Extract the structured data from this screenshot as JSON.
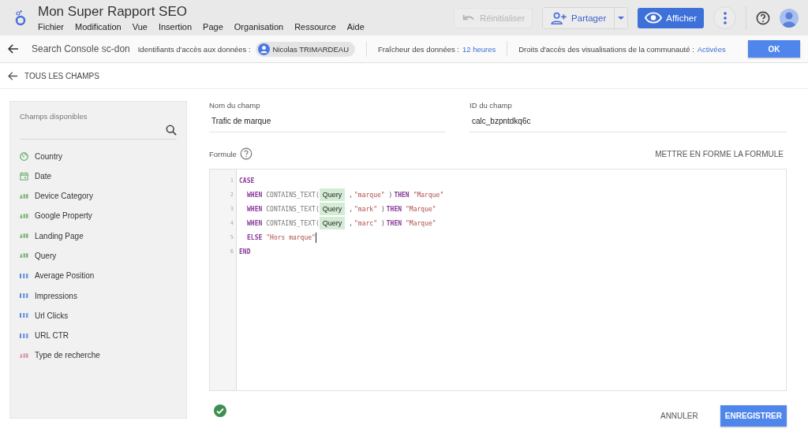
{
  "report": {
    "title": "Mon Super Rapport SEO",
    "menu": [
      "Fichier",
      "Modification",
      "Vue",
      "Insertion",
      "Page",
      "Organisation",
      "Ressource",
      "Aide"
    ]
  },
  "toolbar": {
    "reset": {
      "label": "Réinitialiser",
      "disabled": true
    },
    "share": "Partager",
    "view": "Afficher"
  },
  "source_bar": {
    "source": "Search Console sc-don",
    "credentials_label": "Identifiants d'accès aux données :",
    "owner": "Nicolas TRIMARDEAU",
    "freshness_label": "Fraîcheur des données :",
    "freshness": "12 heures",
    "rights_label": "Droits d'accès des visualisations de la communauté :",
    "rights": "Activées",
    "ok": "OK"
  },
  "back": "TOUS LES CHAMPS",
  "fields_panel": {
    "title": "Champs disponibles",
    "items": [
      {
        "label": "Country",
        "kind": "geo"
      },
      {
        "label": "Date",
        "kind": "date"
      },
      {
        "label": "Device Category",
        "kind": "text"
      },
      {
        "label": "Google Property",
        "kind": "text"
      },
      {
        "label": "Landing Page",
        "kind": "text"
      },
      {
        "label": "Query",
        "kind": "text"
      },
      {
        "label": "Average Position",
        "kind": "number"
      },
      {
        "label": "Impressions",
        "kind": "number"
      },
      {
        "label": "Url Clicks",
        "kind": "number"
      },
      {
        "label": "URL CTR",
        "kind": "number"
      },
      {
        "label": "Type de recherche",
        "kind": "calc"
      }
    ]
  },
  "name_field": {
    "label": "Nom du champ",
    "value": "Trafic de marque"
  },
  "id_field": {
    "label": "ID du champ",
    "value": "calc_bzpntdkq6c"
  },
  "formula": {
    "label": "Formule",
    "format_button": "METTRE EN FORME LA FORMULE",
    "lines": [
      {
        "number": "1",
        "indent": false,
        "tokens": [
          {
            "kind": "keyword",
            "text": "CASE"
          }
        ]
      },
      {
        "number": "2",
        "indent": true,
        "tokens": [
          {
            "kind": "keyword",
            "text": "WHEN"
          },
          {
            "kind": "function",
            "text": "CONTAINS_TEXT("
          },
          {
            "kind": "field",
            "text": "Query"
          },
          {
            "kind": "plain",
            "text": ","
          },
          {
            "kind": "string",
            "text": "\"marque\""
          },
          {
            "kind": "plain",
            "text": ")"
          },
          {
            "kind": "keyword",
            "text": "THEN"
          },
          {
            "kind": "string",
            "text": "\"Marque\""
          }
        ]
      },
      {
        "number": "3",
        "indent": true,
        "tokens": [
          {
            "kind": "keyword",
            "text": "WHEN"
          },
          {
            "kind": "function",
            "text": "CONTAINS_TEXT("
          },
          {
            "kind": "field",
            "text": "Query"
          },
          {
            "kind": "plain",
            "text": ","
          },
          {
            "kind": "string",
            "text": "\"mark\""
          },
          {
            "kind": "plain",
            "text": ")"
          },
          {
            "kind": "keyword",
            "text": "THEN"
          },
          {
            "kind": "string",
            "text": "\"Marque\""
          }
        ]
      },
      {
        "number": "4",
        "indent": true,
        "tokens": [
          {
            "kind": "keyword",
            "text": "WHEN"
          },
          {
            "kind": "function",
            "text": "CONTAINS_TEXT("
          },
          {
            "kind": "field",
            "text": "Query"
          },
          {
            "kind": "plain",
            "text": ","
          },
          {
            "kind": "string",
            "text": "\"marc\""
          },
          {
            "kind": "plain",
            "text": ")"
          },
          {
            "kind": "keyword",
            "text": "THEN"
          },
          {
            "kind": "string",
            "text": "\"Marque\""
          }
        ]
      },
      {
        "number": "5",
        "indent": true,
        "tokens": [
          {
            "kind": "keyword",
            "text": "ELSE"
          },
          {
            "kind": "string",
            "text": "\"Hors marque\""
          }
        ]
      },
      {
        "number": "6",
        "indent": false,
        "tokens": [
          {
            "kind": "keyword",
            "text": "END"
          }
        ]
      }
    ],
    "valid": true
  },
  "actions": {
    "cancel": "ANNULER",
    "save": "ENREGISTRER"
  }
}
